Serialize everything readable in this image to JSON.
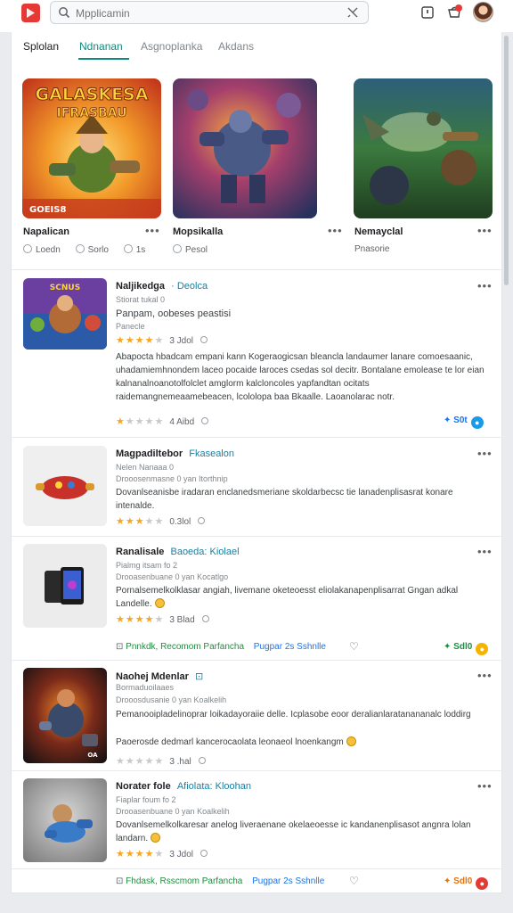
{
  "header": {
    "search_placeholder": "Mpplicamin"
  },
  "tabs": [
    {
      "label": "Splolan"
    },
    {
      "label": "Ndnanan"
    },
    {
      "label": "Asgnoplanka"
    },
    {
      "label": "Akdans"
    }
  ],
  "featured": [
    {
      "title": "Napalican",
      "meta1": "Loedn",
      "meta2": "Sorlo",
      "meta3": "1s",
      "art_text": "GALASKESA",
      "art_text2": "IFRASBAU",
      "art_badge": "GOEIS8"
    },
    {
      "title": "Mopsikalla",
      "meta1": "Pesol"
    },
    {
      "title": "Nemayclal",
      "meta1": "Pnasorie"
    }
  ],
  "items": [
    {
      "title": "Naljikedga",
      "link": "Deolca",
      "sub": "Stiorat tukal 0",
      "headline": "Panpam, oobeses peastisi",
      "sub2": "Panecle",
      "rating": 4,
      "rating_text": "3 Jdol",
      "body": "Abapocta hbadcam empani kann Kogeraogicsan bleancla landaumer lanare comoesaanic, uhadamiemhnondem laceo pocaide laroces csedas sol decitr. Bontalane emolease te lor eian kalnanalnoanotolfolclet amglorm kalcloncoles yapfandtan ocitats raidemangnemeaamebeacen, lcololopa baa Bkaalle. Laoanolarac notr.",
      "rating2": 1,
      "rating2_text": "4 Aibd",
      "chip": "S0t",
      "thumb_text": "SCNUS"
    },
    {
      "title": "Magpadiltebor",
      "link": "Fkasealon",
      "sub": "Nelen Nanaaa 0",
      "sub2": "Drooosenmasne 0   yan Itorthnip",
      "body": "Dovanlseanisbe iradaran enclanedsmeriane skoldarbecsc tie lanadenplisasrat konare intenalde.",
      "rating": 3,
      "rating_text": "0.3lol"
    },
    {
      "title": "Ranalisale",
      "link": "Baoeda:  Kiolael",
      "sub": "Pialmg itsam fo 2",
      "sub2": "Drooasenbuane 0   yan Kocatlgo",
      "body": "Pornalsemelkolklasar angiah, livemane oketeoesst eliolakanapenplisarrat Gngan adkal Landelle.",
      "rating": 4,
      "rating_text": "3 Blad",
      "act_green": "Pnnkdk, Recomom Parfancha",
      "act_blue": "Pugpar 2s Sshnlle",
      "chip": "Sdl0"
    },
    {
      "title": "Naohej Mdenlar",
      "link": "",
      "sub": "Bormaduoilaaes",
      "sub2": "Drooosdusanie 0   yan Koalkelih",
      "body": "Pemanooipladelinoprar loikadayoraiie delle. Icplasobe eoor deralianlaratanananalc loddirg",
      "body2": "Paoerosde dedmarl kancerocaolata leonaeol lnoenkangm",
      "rating": 0,
      "rating_text": "3 .hal",
      "thumb_text": "OA"
    },
    {
      "title": "Norater fole",
      "link": "Afiolata:  Kloohan",
      "sub": "Fiaplar foum fo 2",
      "sub2": "Drooasenbuane 0   yan Koalkelih",
      "body": "Dovanlsemelkolkaresar anelog liveraenane okelaeoesse ic kandanenplisasot angnra lolan landarn.",
      "rating": 4,
      "rating_text": "3 Jdol",
      "act_green": "Fhdask, Rsscmom Parfancha",
      "act_blue": "Pugpar 2s Sshnlle",
      "chip": "Sdl0"
    }
  ],
  "colors": {
    "accent": "#0f8a7d",
    "star": "#f5a623",
    "link": "#1a7fa0",
    "green": "#1e8e3e"
  }
}
